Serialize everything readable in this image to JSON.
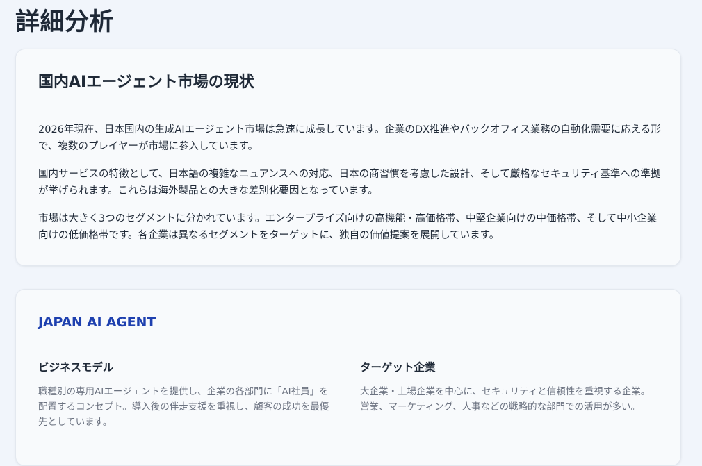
{
  "page": {
    "title": "詳細分析"
  },
  "market_card": {
    "heading": "国内AIエージェント市場の現状",
    "paragraphs": [
      "2026年現在、日本国内の生成AIエージェント市場は急速に成長しています。企業のDX推進やバックオフィス業務の自動化需要に応える形で、複数のプレイヤーが市場に参入しています。",
      "国内サービスの特徴として、日本語の複雑なニュアンスへの対応、日本の商習慣を考慮した設計、そして厳格なセキュリティ基準への準拠が挙げられます。これらは海外製品との大きな差別化要因となっています。",
      "市場は大きく3つのセグメントに分かれています。エンタープライズ向けの高機能・高価格帯、中堅企業向けの中価格帯、そして中小企業向けの低価格帯です。各企業は異なるセグメントをターゲットに、独自の価値提案を展開しています。"
    ]
  },
  "company_card": {
    "name": "JAPAN AI AGENT",
    "business_model": {
      "title": "ビジネスモデル",
      "body": "職種別の専用AIエージェントを提供し、企業の各部門に「AI社員」を配置するコンセプト。導入後の伴走支援を重視し、顧客の成功を最優先としています。"
    },
    "target": {
      "title": "ターゲット企業",
      "body": "大企業・上場企業を中心に、セキュリティと信頼性を重視する企業。営業、マーケティング、人事などの戦略的な部門での活用が多い。"
    }
  },
  "colors": {
    "background": "#f1f5fb",
    "card": "#f8fafc",
    "heading_text": "#1f2937",
    "muted_text": "#6b7280",
    "accent": "#1e40af"
  }
}
